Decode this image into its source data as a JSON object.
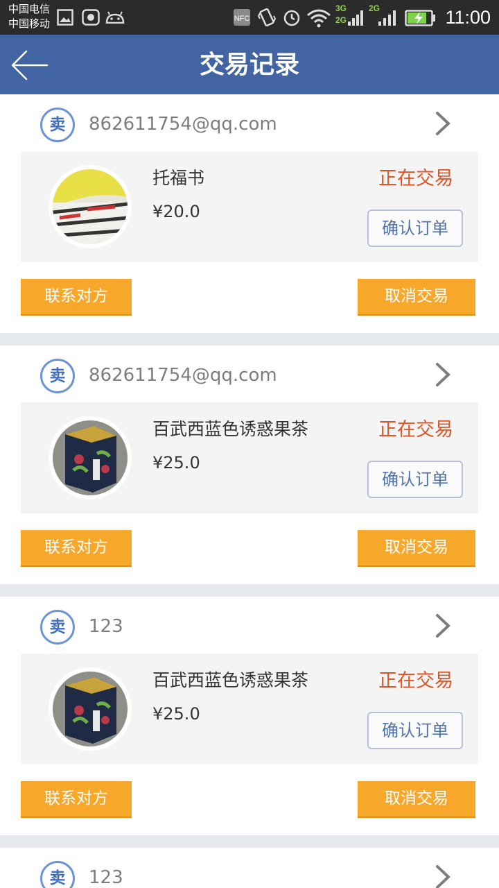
{
  "statusbar": {
    "carrier1": "中国电信",
    "carrier2": "中国移动",
    "net1": "3G",
    "net2": "2G",
    "net3": "2G",
    "nfc": "NFC",
    "time": "11:00"
  },
  "header": {
    "title": "交易记录",
    "back_icon": "back-arrow-icon"
  },
  "orders": [
    {
      "badge": "卖",
      "seller": "862611754@qq.com",
      "item_name": "托福书",
      "price": "¥20.0",
      "status": "正在交易",
      "confirm_label": "确认订单",
      "contact_label": "联系对方",
      "cancel_label": "取消交易",
      "thumb": "book-thumbnail"
    },
    {
      "badge": "卖",
      "seller": "862611754@qq.com",
      "item_name": "百武西蓝色诱惑果茶",
      "price": "¥25.0",
      "status": "正在交易",
      "confirm_label": "确认订单",
      "contact_label": "联系对方",
      "cancel_label": "取消交易",
      "thumb": "tea-tin-thumbnail"
    },
    {
      "badge": "卖",
      "seller": "123",
      "item_name": "百武西蓝色诱惑果茶",
      "price": "¥25.0",
      "status": "正在交易",
      "confirm_label": "确认订单",
      "contact_label": "联系对方",
      "cancel_label": "取消交易",
      "thumb": "tea-tin-thumbnail"
    },
    {
      "badge": "卖",
      "seller": "123"
    }
  ],
  "colors": {
    "header_bg": "#4264a2",
    "status_text": "#e05526",
    "action_button": "#f7a72a",
    "badge_border": "#6b93d6"
  }
}
